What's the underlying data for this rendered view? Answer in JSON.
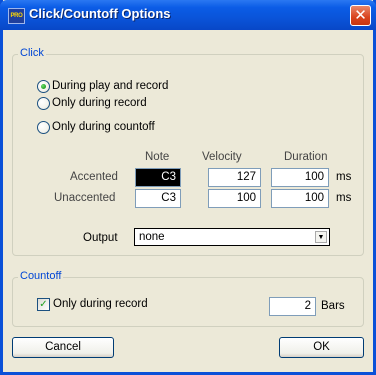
{
  "window": {
    "title": "Click/Countoff Options",
    "app_icon_text": "PRO",
    "close_glyph": "✕"
  },
  "click_group": {
    "title": "Click",
    "options": [
      {
        "label": "During play and record",
        "checked": true
      },
      {
        "label": "Only during record",
        "checked": false
      },
      {
        "label": "Only during countoff",
        "checked": false
      }
    ],
    "columns": {
      "note": "Note",
      "velocity": "Velocity",
      "duration": "Duration"
    },
    "accented": {
      "label": "Accented",
      "note": "C3",
      "velocity": "127",
      "duration": "100",
      "unit": "ms"
    },
    "unaccented": {
      "label": "Unaccented",
      "note": "C3",
      "velocity": "100",
      "duration": "100",
      "unit": "ms"
    },
    "output": {
      "label": "Output",
      "value": "none",
      "arrow": "▼"
    }
  },
  "countoff_group": {
    "title": "Countoff",
    "only_during_record": {
      "label": "Only during record",
      "checked": true,
      "mark": "✓"
    },
    "bars": {
      "value": "2",
      "unit": "Bars"
    }
  },
  "buttons": {
    "cancel": "Cancel",
    "ok": "OK"
  },
  "icons": [
    "pro-app-icon",
    "close-icon",
    "radio-selected-icon",
    "radio-icon",
    "checkbox-checked-icon",
    "dropdown-arrow-icon"
  ]
}
